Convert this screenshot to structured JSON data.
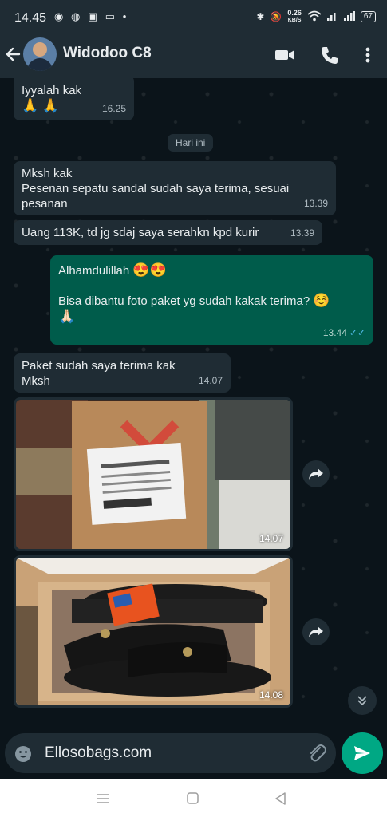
{
  "status_bar": {
    "time": "14.45",
    "speed_value": "0.26",
    "speed_unit": "KB/S",
    "battery": "67"
  },
  "header": {
    "contact_name": "Widodoo C8"
  },
  "chat": {
    "date_chip": "Hari ini",
    "messages": [
      {
        "direction": "in",
        "lines": [
          "Iyyalah  kak"
        ],
        "emoji": "🙏 🙏",
        "time": "16.25"
      },
      {
        "direction": "in",
        "lines": [
          "Mksh kak",
          "Pesenan sepatu sandal sudah saya terima, sesuai",
          "pesanan"
        ],
        "time": "13.39"
      },
      {
        "direction": "in",
        "lines": [
          "Uang 113K, td jg sdaj saya serahkn kpd  kurir"
        ],
        "time": "13.39"
      },
      {
        "direction": "out",
        "line1": "Alhamdulillah",
        "line1_emoji": "😍😍",
        "line2": "Bisa dibantu foto paket yg sudah kakak terima?",
        "line2_emoji": "☺️",
        "line3_emoji": "🙏🏻",
        "time": "13.44",
        "ticks": "✓✓"
      },
      {
        "direction": "in",
        "lines": [
          "Paket sudah saya terima kak",
          "Mksh"
        ],
        "time": "14.07"
      },
      {
        "direction": "in",
        "type": "image",
        "image_name": "package-box-photo",
        "time": "14.07"
      },
      {
        "direction": "in",
        "type": "image",
        "image_name": "sandals-in-box-photo",
        "time": "14.08"
      }
    ]
  },
  "composer": {
    "input_value": "Ellosobags.com"
  },
  "colors": {
    "header_bg": "#1f2c34",
    "chat_bg": "#0b141a",
    "incoming_bubble": "#1f2c34",
    "outgoing_bubble": "#005c4b",
    "accent": "#00a884",
    "read_ticks": "#53bdeb"
  },
  "icons": [
    "back-arrow-icon",
    "video-call-icon",
    "phone-icon",
    "more-options-icon",
    "emoji-icon",
    "attach-icon",
    "send-icon",
    "forward-icon",
    "scroll-down-icon",
    "recents-icon",
    "home-icon",
    "back-icon"
  ]
}
